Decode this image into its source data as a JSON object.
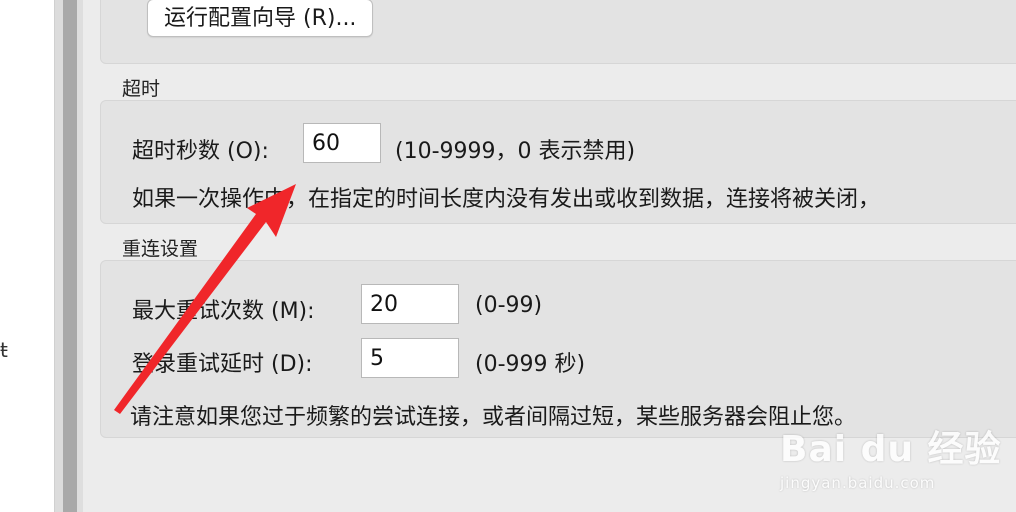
{
  "left_pane": {
    "stub_text": "ŧ"
  },
  "top": {
    "wizard_button": "运行配置向导 (R)..."
  },
  "timeout": {
    "section": "超时",
    "label": "超时秒数 (O):",
    "value": "60",
    "range": "(10-9999，0 表示禁用)",
    "note": "如果一次操作中，在指定的时间长度内没有发出或收到数据，连接将被关闭，"
  },
  "reconnect": {
    "section": "重连设置",
    "max_retries_label": "最大重试次数 (M):",
    "max_retries_value": "20",
    "max_retries_range": "(0-99)",
    "delay_label": "登录重试延时 (D):",
    "delay_value": "5",
    "delay_range": "(0-999 秒)",
    "note": "请注意如果您过于频繁的尝试连接，或者间隔过短，某些服务器会阻止您。"
  },
  "watermark": {
    "logo": "Bai du 经验",
    "url": "jingyan.baidu.com"
  },
  "colors": {
    "arrow": "#f0262a",
    "panel": "#e3e3e3",
    "background": "#ececec"
  }
}
